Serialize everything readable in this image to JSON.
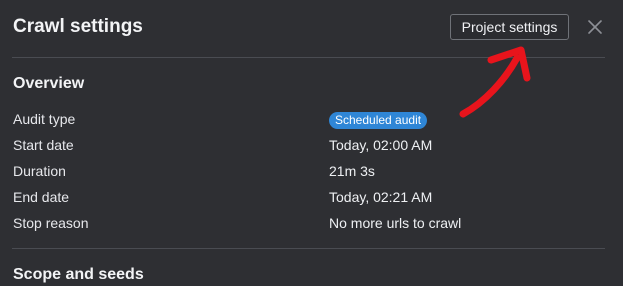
{
  "header": {
    "title": "Crawl settings",
    "project_settings_label": "Project settings"
  },
  "overview": {
    "title": "Overview",
    "rows": [
      {
        "label": "Audit type",
        "value": "Scheduled audit"
      },
      {
        "label": "Start date",
        "value": "Today, 02:00 AM"
      },
      {
        "label": "Duration",
        "value": "21m 3s"
      },
      {
        "label": "End date",
        "value": "Today, 02:21 AM"
      },
      {
        "label": "Stop reason",
        "value": "No more urls to crawl"
      }
    ]
  },
  "scope": {
    "title": "Scope and seeds"
  },
  "colors": {
    "background": "#2e2f33",
    "badge": "#2f86d6",
    "annotation_arrow": "#e8141c"
  }
}
